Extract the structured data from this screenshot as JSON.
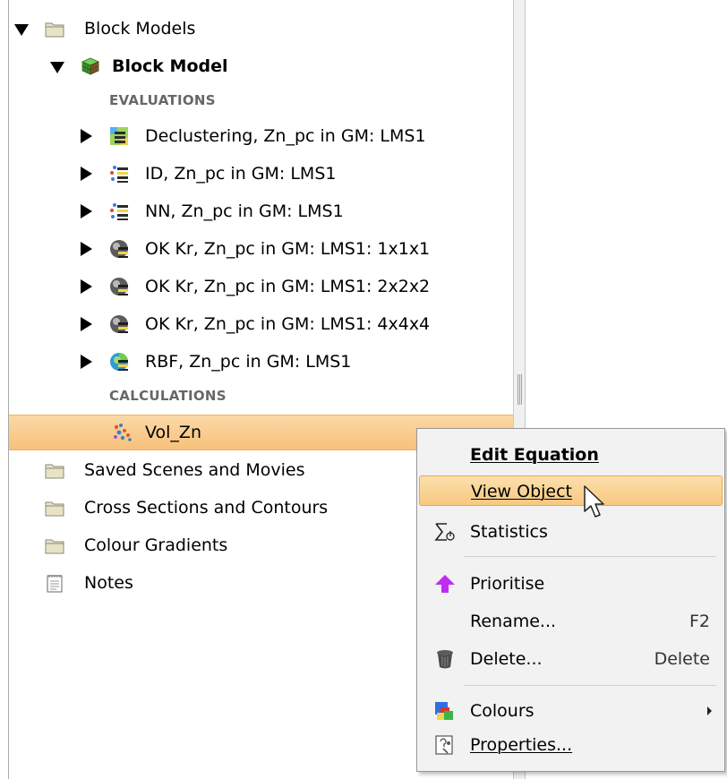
{
  "tree": {
    "block_models": "Block Models",
    "block_model": "Block Model",
    "evaluations_header": "EVALUATIONS",
    "evaluations": [
      {
        "label": "Declustering, Zn_pc in GM: LMS1",
        "icon": "declustering-icon"
      },
      {
        "label": "ID, Zn_pc in GM: LMS1",
        "icon": "id-estimator-icon"
      },
      {
        "label": "NN, Zn_pc in GM: LMS1",
        "icon": "nn-estimator-icon"
      },
      {
        "label": "OK Kr, Zn_pc in GM: LMS1: 1x1x1",
        "icon": "kriging-icon"
      },
      {
        "label": "OK Kr, Zn_pc in GM: LMS1: 2x2x2",
        "icon": "kriging-icon"
      },
      {
        "label": "OK Kr, Zn_pc in GM: LMS1: 4x4x4",
        "icon": "kriging-icon"
      },
      {
        "label": "RBF, Zn_pc in GM: LMS1",
        "icon": "rbf-icon"
      }
    ],
    "calculations_header": "CALCULATIONS",
    "calculation_item": "Vol_Zn",
    "folders": [
      {
        "label": "Saved Scenes and Movies",
        "icon": "folder-icon"
      },
      {
        "label": "Cross Sections and Contours",
        "icon": "folder-icon"
      },
      {
        "label": "Colour Gradients",
        "icon": "folder-icon"
      },
      {
        "label": "Notes",
        "icon": "notes-icon"
      }
    ]
  },
  "context_menu": {
    "edit_equation": "Edit Equation",
    "view_object": "View Object",
    "statistics": "Statistics",
    "prioritise": "Prioritise",
    "rename": "Rename...",
    "rename_shortcut": "F2",
    "delete": "Delete...",
    "delete_shortcut": "Delete",
    "colours": "Colours",
    "properties": "Properties..."
  },
  "colors": {
    "selection": "#f7c17a",
    "menu_hover": "#fcdfae",
    "folder": "#e8e2c4",
    "prioritise_arrow": "#c02cf0"
  }
}
